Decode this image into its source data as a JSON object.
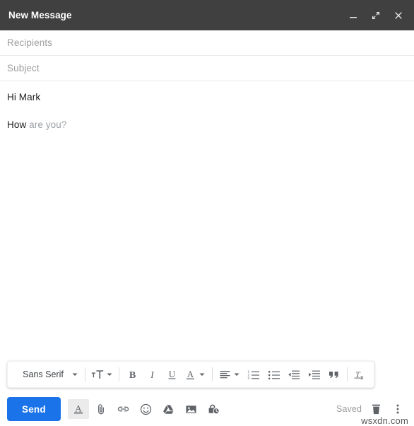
{
  "window": {
    "title": "New Message",
    "titlebar_color": "#404040",
    "controls": [
      {
        "name": "minimize",
        "icon": "minimize-icon"
      },
      {
        "name": "expand",
        "icon": "expand-icon"
      },
      {
        "name": "close",
        "icon": "close-icon"
      }
    ]
  },
  "fields": {
    "recipients_placeholder": "Recipients",
    "recipients_value": "",
    "subject_placeholder": "Subject",
    "subject_value": ""
  },
  "body": {
    "greeting": "Hi Mark",
    "typed_text": "How",
    "suggestion_text": " are you?"
  },
  "format_toolbar": {
    "font_label": "Sans Serif",
    "items": [
      {
        "label": "Font",
        "icon": "font-family-dropdown"
      },
      {
        "label": "Size",
        "icon": "text-size-icon"
      },
      {
        "label": "Bold",
        "icon": "bold-icon"
      },
      {
        "label": "Italic",
        "icon": "italic-icon"
      },
      {
        "label": "Underline",
        "icon": "underline-icon"
      },
      {
        "label": "Text color",
        "icon": "text-color-icon"
      },
      {
        "label": "Align",
        "icon": "align-left-icon"
      },
      {
        "label": "Numbered list",
        "icon": "numbered-list-icon"
      },
      {
        "label": "Bulleted list",
        "icon": "bulleted-list-icon"
      },
      {
        "label": "Indent less",
        "icon": "indent-less-icon"
      },
      {
        "label": "Indent more",
        "icon": "indent-more-icon"
      },
      {
        "label": "Quote",
        "icon": "quote-icon"
      },
      {
        "label": "Remove formatting",
        "icon": "remove-formatting-icon"
      }
    ]
  },
  "bottom_bar": {
    "send_label": "Send",
    "send_color": "#1a73e8",
    "icons": [
      {
        "label": "Formatting options",
        "icon": "formatting-icon",
        "active": true
      },
      {
        "label": "Attach files",
        "icon": "attachment-icon",
        "active": false
      },
      {
        "label": "Insert link",
        "icon": "link-icon",
        "active": false
      },
      {
        "label": "Insert emoji",
        "icon": "emoji-icon",
        "active": false
      },
      {
        "label": "Insert files using Drive",
        "icon": "google-drive-icon",
        "active": false
      },
      {
        "label": "Insert photo",
        "icon": "photo-icon",
        "active": false
      },
      {
        "label": "Confidential mode",
        "icon": "confidential-mode-icon",
        "active": false
      }
    ],
    "saved_label": "Saved",
    "trash_label": "Discard draft",
    "more_label": "More options"
  },
  "watermark": "wsxdn.com"
}
